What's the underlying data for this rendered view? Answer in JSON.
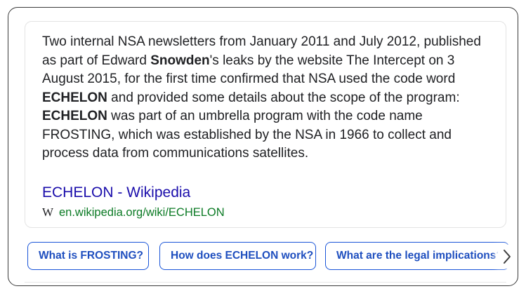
{
  "answer": {
    "snippet_parts": [
      {
        "text": "Two internal NSA newsletters from January 2011 and July 2012, published as part of Edward ",
        "bold": false
      },
      {
        "text": "Snowden",
        "bold": true
      },
      {
        "text": "'s leaks by the website The Intercept on 3 August 2015, for the first time confirmed that NSA used the code word ",
        "bold": false
      },
      {
        "text": "ECHELON",
        "bold": true
      },
      {
        "text": " and provided some details about the scope of the program: ",
        "bold": false
      },
      {
        "text": "ECHELON",
        "bold": true
      },
      {
        "text": " was part of an umbrella program with the code name FROSTING, which was established by the NSA in 1966 to collect and process data from communications satellites.",
        "bold": false
      }
    ],
    "source": {
      "title": "ECHELON - Wikipedia",
      "icon": "wikipedia-w-icon",
      "icon_glyph": "W",
      "url": "en.wikipedia.org/wiki/ECHELON"
    }
  },
  "suggestions": [
    "What is FROSTING?",
    "How does ECHELON work?",
    "What are the legal implications?"
  ],
  "colors": {
    "link_title": "#1a0dab",
    "url_green": "#0b7a24",
    "chip_border": "#1a55d8",
    "chip_text": "#1f4fbf",
    "body_text": "#202124"
  },
  "icons": {
    "next": "chevron-right-icon"
  }
}
